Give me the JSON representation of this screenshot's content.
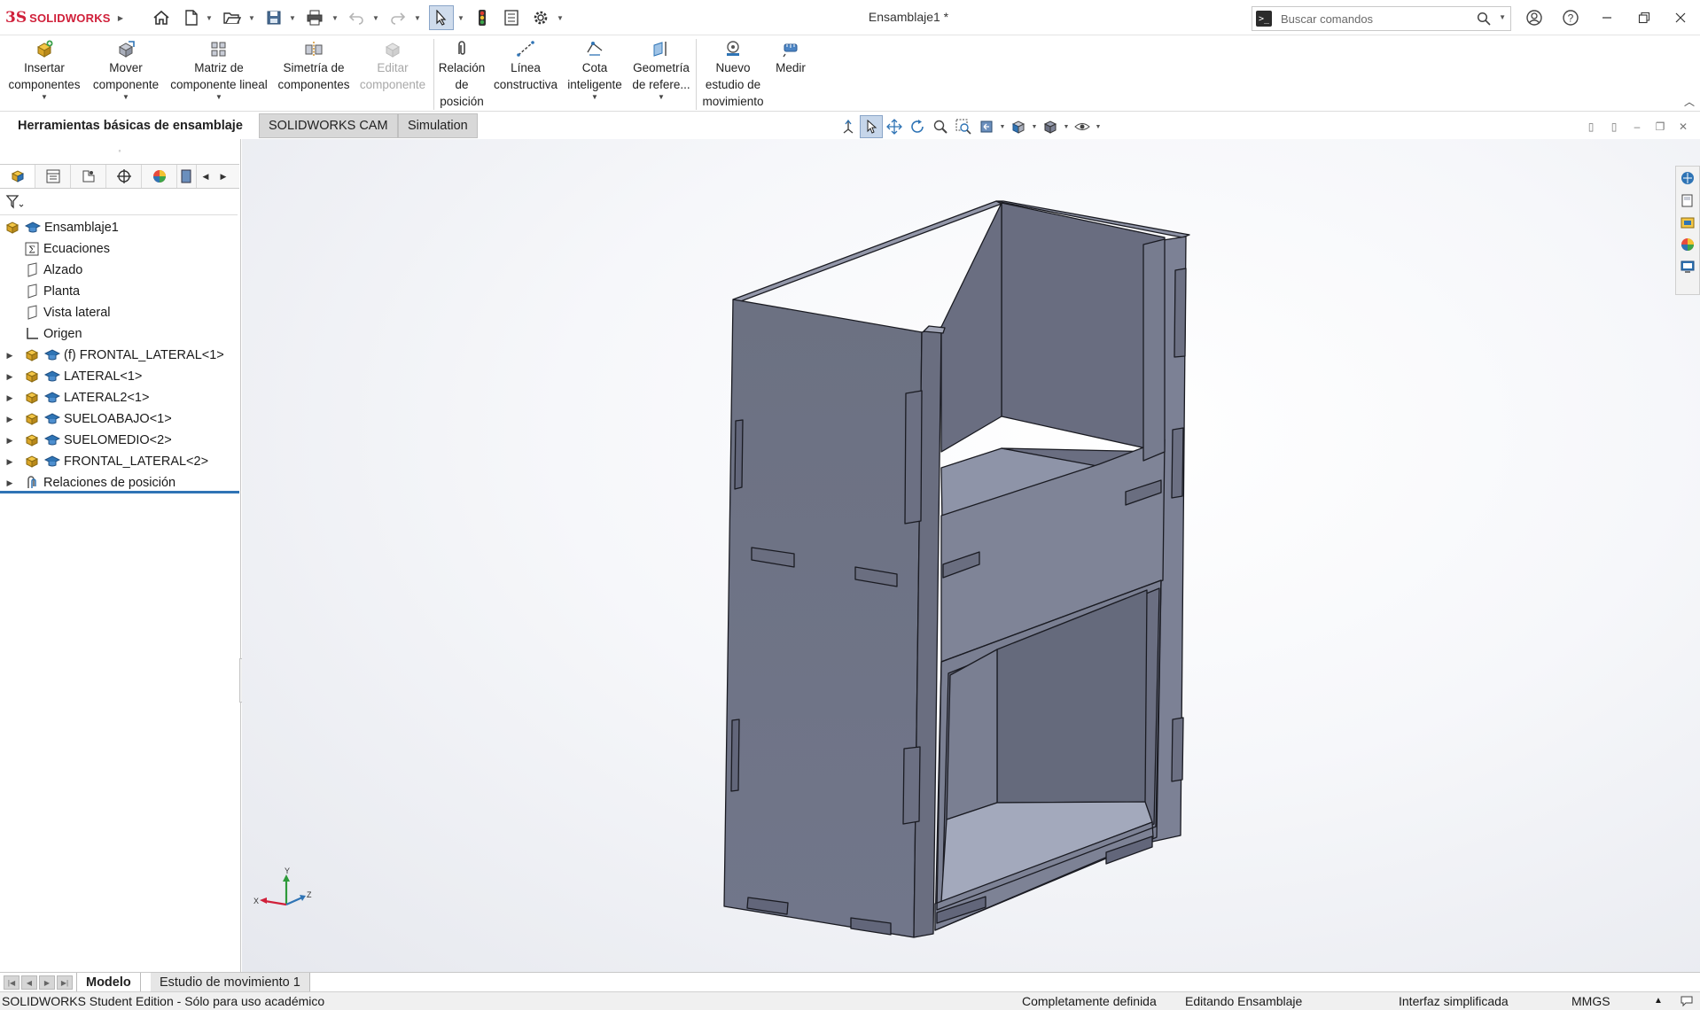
{
  "app": {
    "logo_mark": "3S",
    "logo_text": "SOLIDWORKS",
    "window_title": "Ensamblaje1 *"
  },
  "search": {
    "placeholder": "Buscar comandos"
  },
  "ribbon": {
    "insert": [
      "Insertar",
      "componentes"
    ],
    "move": [
      "Mover",
      "componente"
    ],
    "pattern": [
      "Matriz de",
      "componente lineal"
    ],
    "mirror": [
      "Simetría de",
      "componentes"
    ],
    "edit": [
      "Editar",
      "componente"
    ],
    "mate": [
      "Relación",
      "de",
      "posición"
    ],
    "sketch_line": [
      "Línea",
      "constructiva"
    ],
    "smart_dim": [
      "Cota",
      "inteligente"
    ],
    "ref_geom": [
      "Geometría",
      "de refere..."
    ],
    "motion_study": [
      "Nuevo",
      "estudio de",
      "movimiento"
    ],
    "measure": [
      "Medir"
    ]
  },
  "command_tabs": {
    "assembly": "Herramientas básicas de ensamblaje",
    "cam": "SOLIDWORKS CAM",
    "simulation": "Simulation"
  },
  "tree": {
    "root": "Ensamblaje1",
    "items": [
      "Ecuaciones",
      "Alzado",
      "Planta",
      "Vista lateral",
      "Origen",
      "(f) FRONTAL_LATERAL<1>",
      "LATERAL<1>",
      "LATERAL2<1>",
      "SUELOABAJO<1>",
      "SUELOMEDIO<2>",
      "FRONTAL_LATERAL<2>",
      "Relaciones de posición"
    ]
  },
  "triad": {
    "x": "X",
    "y": "Y",
    "z": "Z"
  },
  "bottom_tabs": {
    "model": "Modelo",
    "motion": "Estudio de movimiento 1"
  },
  "status": {
    "edition": "SOLIDWORKS Student Edition - Sólo para uso académico",
    "definition": "Completamente definida",
    "editing": "Editando Ensamblaje",
    "interface": "Interfaz simplificada",
    "units": "MMGS"
  },
  "colors": {
    "brand": "#d0203a",
    "accent": "#2f74b5",
    "model_face": "#7c8193",
    "model_dark": "#676b7d"
  }
}
